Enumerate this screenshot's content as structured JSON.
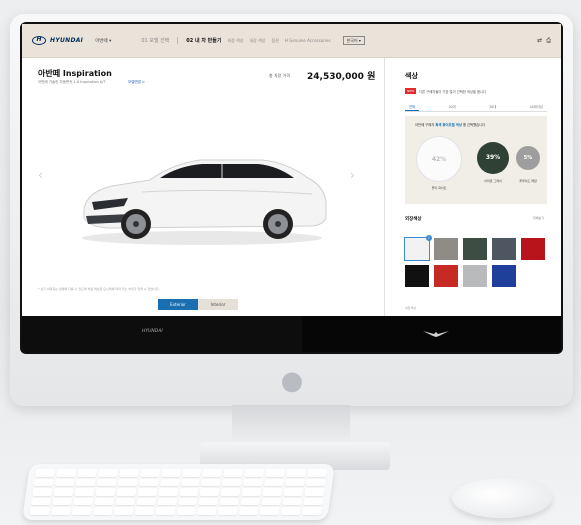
{
  "header": {
    "brand": "HYUNDAI",
    "model_select": "아반떼 ▾",
    "steps": [
      {
        "label": "01 모델 선택",
        "active": false
      },
      {
        "label": "02 내 차 만들기",
        "active": true
      }
    ],
    "substeps": [
      "외장 색상",
      "내장 색상",
      "옵션",
      "H Genuine Accessories"
    ],
    "lang_select": "한국어 ▾",
    "icons": [
      "share-icon",
      "print-icon"
    ]
  },
  "car": {
    "title": "아반떼 Inspiration",
    "subtitle": "아반떼 가솔린 자동변속 1.6 Inspiration A/T",
    "change_link": "모델변경 >",
    "price_label": "총 차량 가격",
    "price": "24,530,000 원",
    "disclaimer": "* 상기 이미지는 실제와 다를 수 있으며 차량 색상은 모니터에 따라 다소 차이가 있을 수 있습니다.",
    "view_exterior": "Exterior",
    "view_interior": "Interior"
  },
  "color_panel": {
    "title": "색상",
    "notice_badge": "NEW",
    "notice_text": "다른 구매자들이 가장 많이 선택한 색상을 봅니다",
    "tabs": [
      {
        "label": "전체",
        "active": true
      },
      {
        "label": "20대",
        "active": false
      },
      {
        "label": "30대",
        "active": false
      },
      {
        "label": "40대이상",
        "active": false
      }
    ],
    "stat_prefix": "아반떼 구매자",
    "stat_highlight": "흑색 화이트펄 색상",
    "stat_suffix": "를 선택했습니다",
    "stats": [
      {
        "value": "42%",
        "label": "폴라 화이트"
      },
      {
        "value": "39%",
        "label": "아마존 그레이"
      },
      {
        "value": "5%",
        "label": "플루이드 메탈"
      }
    ],
    "exterior_title": "외장색상",
    "exterior_more": "전체보기",
    "swatches": [
      {
        "color": "#f2f2f2",
        "name": "white",
        "selected": true
      },
      {
        "color": "#8f8c88",
        "name": "gray",
        "selected": false
      },
      {
        "color": "#3d4d43",
        "name": "green",
        "selected": false
      },
      {
        "color": "#4e5661",
        "name": "slate",
        "selected": false
      },
      {
        "color": "#b8141c",
        "name": "red",
        "selected": false
      },
      {
        "color": "#111111",
        "name": "black",
        "selected": false
      },
      {
        "color": "#c62a25",
        "name": "red-2",
        "selected": false
      },
      {
        "color": "#b9babb",
        "name": "silver",
        "selected": false
      },
      {
        "color": "#1f3f9a",
        "name": "blue",
        "selected": false
      }
    ],
    "interior_hint": "내장색상"
  },
  "footer": {
    "brand": "HYUNDAI"
  },
  "colors": {
    "accent": "#1a6fb0",
    "nav_bg": "#e9e3d9",
    "badge": "#e32b2b"
  }
}
